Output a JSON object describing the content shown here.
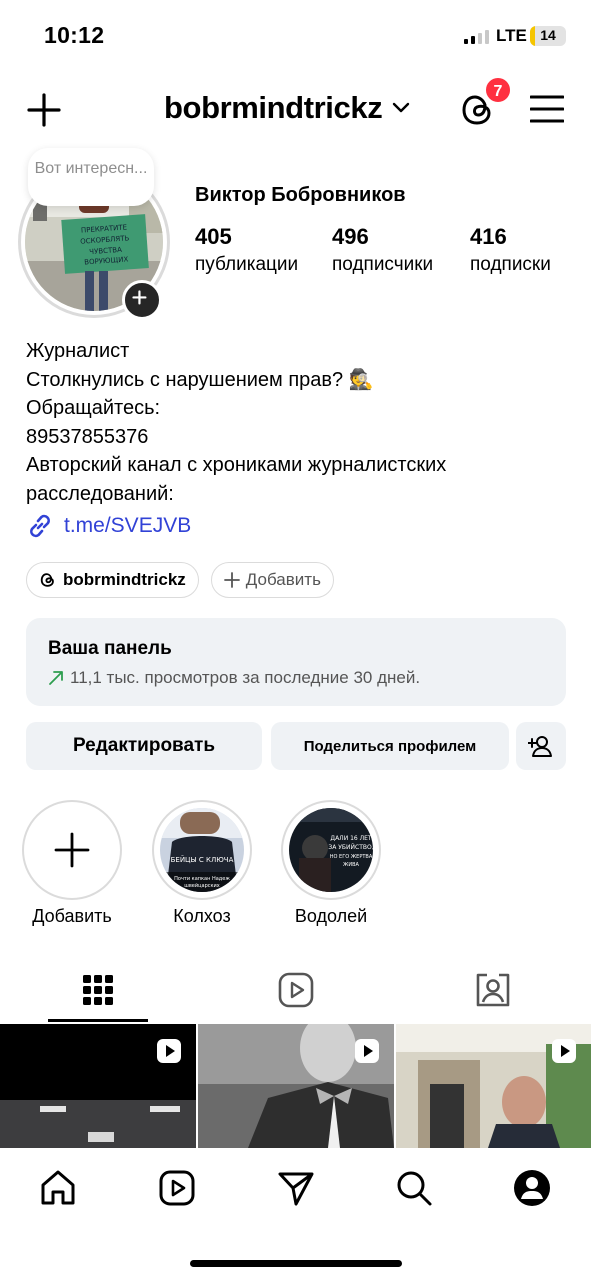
{
  "status_bar": {
    "time": "10:12",
    "network": "LTE",
    "battery": "14",
    "battery_level": 0.14
  },
  "header": {
    "username": "bobrmindtrickz",
    "notification_count": "7"
  },
  "profile": {
    "note": "Вот интересн...",
    "full_name": "Виктор Бобровников",
    "stats": [
      {
        "value": "405",
        "label": "публикации"
      },
      {
        "value": "496",
        "label": "подписчики"
      },
      {
        "value": "416",
        "label": "подписки"
      }
    ],
    "bio_lines": [
      "Журналист",
      "Столкнулись с нарушением прав? 🕵️",
      "Обращайтесь:",
      "89537855376",
      "Авторский канал с хрониками журналистских",
      "расследований:"
    ],
    "link": "t.me/SVEJVB",
    "avatar_sign_text": "ПРЕКРАТИТЕ ОСКОРБЛЯТЬ ЧУВСТВА ВОРУЮЩИХ"
  },
  "chips": {
    "threads_handle": "bobrmindtrickz",
    "add_label": "Добавить"
  },
  "dashboard": {
    "title": "Ваша панель",
    "subtitle": "11,1 тыс. просмотров за последние 30 дней."
  },
  "actions": {
    "edit": "Редактировать",
    "share": "Поделиться профилем"
  },
  "highlights": [
    {
      "label": "Добавить"
    },
    {
      "label": "Колхоз",
      "overlay_text": "Почти капкан Надеж... ... швейцарских"
    },
    {
      "label": "Водолей",
      "overlay_text": "ДАЛИ 16 ЛЕТ ЗА УБИЙСТВО, НО ЕГО ЖЕРТВА ЖИВА"
    }
  ],
  "colors": {
    "accent_link": "#3142d6",
    "badge": "#ff3040",
    "button_bg": "#eff2f5",
    "trend_green": "#2e9e4f"
  },
  "icons": {
    "top": [
      "plus-icon",
      "chevron-down-icon",
      "threads-icon",
      "menu-icon"
    ],
    "tabs": [
      "grid-icon",
      "reels-icon",
      "tagged-icon"
    ],
    "nav": [
      "home-icon",
      "reels-icon",
      "direct-icon",
      "search-icon",
      "profile-icon"
    ]
  }
}
